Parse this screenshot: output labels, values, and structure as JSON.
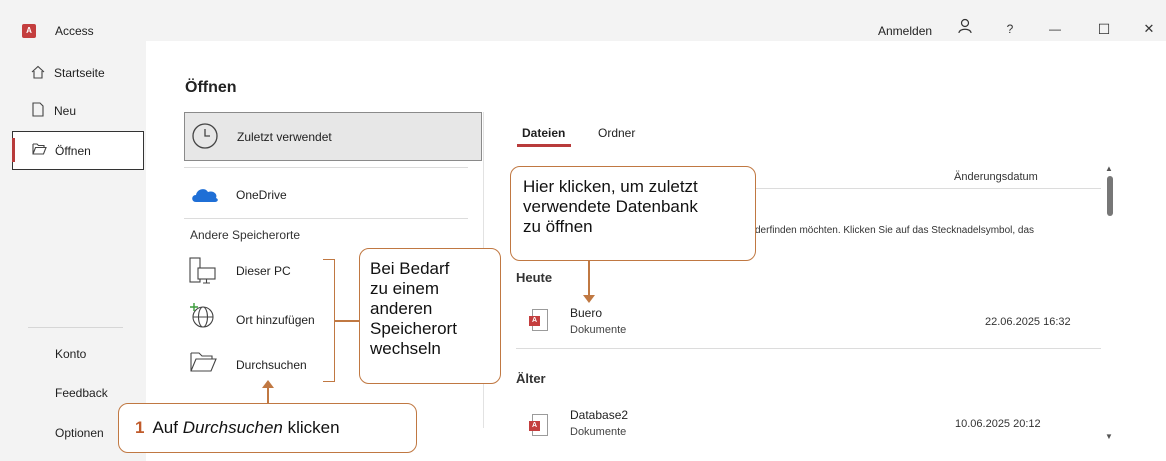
{
  "titlebar": {
    "app_icon_text": "A",
    "app_name": "Access",
    "signin": "Anmelden",
    "help": "?",
    "minimize": "—",
    "maximize": "☐",
    "close": "✕"
  },
  "sidebar": {
    "items": [
      {
        "label": "Startseite",
        "icon": "home-icon"
      },
      {
        "label": "Neu",
        "icon": "new-document-icon"
      },
      {
        "label": "Öffnen",
        "icon": "folder-open-icon"
      }
    ],
    "bottom": [
      "Konto",
      "Feedback",
      "Optionen"
    ]
  },
  "main": {
    "title": "Öffnen",
    "recent_label": "Zuletzt verwendet",
    "onedrive_label": "OneDrive",
    "other_locations_heading": "Andere Speicherorte",
    "locations": [
      "Dieser PC",
      "Ort hinzufügen",
      "Durchsuchen"
    ]
  },
  "files": {
    "tabs": [
      "Dateien",
      "Ordner"
    ],
    "column_header": "Änderungsdatum",
    "hint_text": "derfinden möchten. Klicken Sie auf das Stecknadelsymbol, das",
    "groups": [
      {
        "title": "Heute",
        "items": [
          {
            "name": "Buero",
            "location": "Dokumente",
            "date": "22.06.2025 16:32"
          }
        ]
      },
      {
        "title": "Älter",
        "items": [
          {
            "name": "Database2",
            "location": "Dokumente",
            "date": "10.06.2025 20:12"
          }
        ]
      }
    ]
  },
  "callouts": {
    "recent": [
      "Hier klicken, um zuletzt",
      "verwendete Datenbank",
      "zu öffnen"
    ],
    "location": [
      "Bei Bedarf",
      "zu einem",
      "anderen",
      "Speicherort",
      "wechseln"
    ],
    "step_number": "1",
    "step_text_pre": "Auf ",
    "step_text_em": "Durchsuchen",
    "step_text_post": " klicken"
  },
  "colors": {
    "accent": "#b83b3b",
    "callout_border": "#c07842",
    "sidebar_bg": "#f3f3f3"
  }
}
